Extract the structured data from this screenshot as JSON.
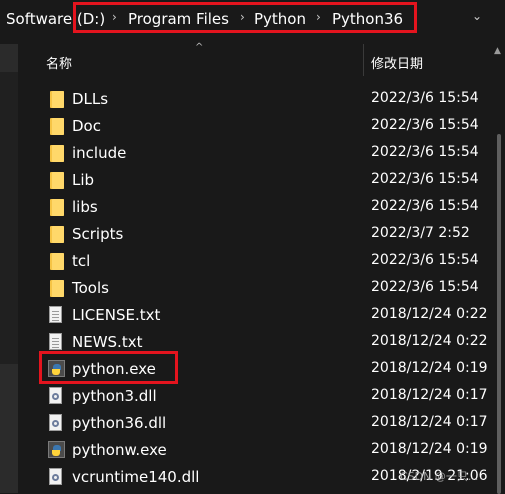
{
  "address": {
    "crumbs": [
      "Software (D:)",
      "Program Files",
      "Python",
      "Python36"
    ],
    "separator": "›",
    "dropdown": "⌄"
  },
  "header": {
    "name_col": "名称",
    "date_col": "修改日期",
    "sort_indicator": "^"
  },
  "files": [
    {
      "name": "DLLs",
      "date": "2022/3/6 15:54",
      "kind": "folder"
    },
    {
      "name": "Doc",
      "date": "2022/3/6 15:54",
      "kind": "folder"
    },
    {
      "name": "include",
      "date": "2022/3/6 15:54",
      "kind": "folder"
    },
    {
      "name": "Lib",
      "date": "2022/3/6 15:54",
      "kind": "folder"
    },
    {
      "name": "libs",
      "date": "2022/3/6 15:54",
      "kind": "folder"
    },
    {
      "name": "Scripts",
      "date": "2022/3/7 2:52",
      "kind": "folder"
    },
    {
      "name": "tcl",
      "date": "2022/3/6 15:54",
      "kind": "folder"
    },
    {
      "name": "Tools",
      "date": "2022/3/6 15:54",
      "kind": "folder"
    },
    {
      "name": "LICENSE.txt",
      "date": "2018/12/24 0:22",
      "kind": "text"
    },
    {
      "name": "NEWS.txt",
      "date": "2018/12/24 0:22",
      "kind": "text"
    },
    {
      "name": "python.exe",
      "date": "2018/12/24 0:19",
      "kind": "python-exe"
    },
    {
      "name": "python3.dll",
      "date": "2018/12/24 0:17",
      "kind": "dll"
    },
    {
      "name": "python36.dll",
      "date": "2018/12/24 0:17",
      "kind": "dll"
    },
    {
      "name": "pythonw.exe",
      "date": "2018/12/24 0:19",
      "kind": "python-exe"
    },
    {
      "name": "vcruntime140.dll",
      "date": "2018/2/19 21:06",
      "kind": "dll"
    }
  ],
  "watermark": "CSDN @一只..."
}
